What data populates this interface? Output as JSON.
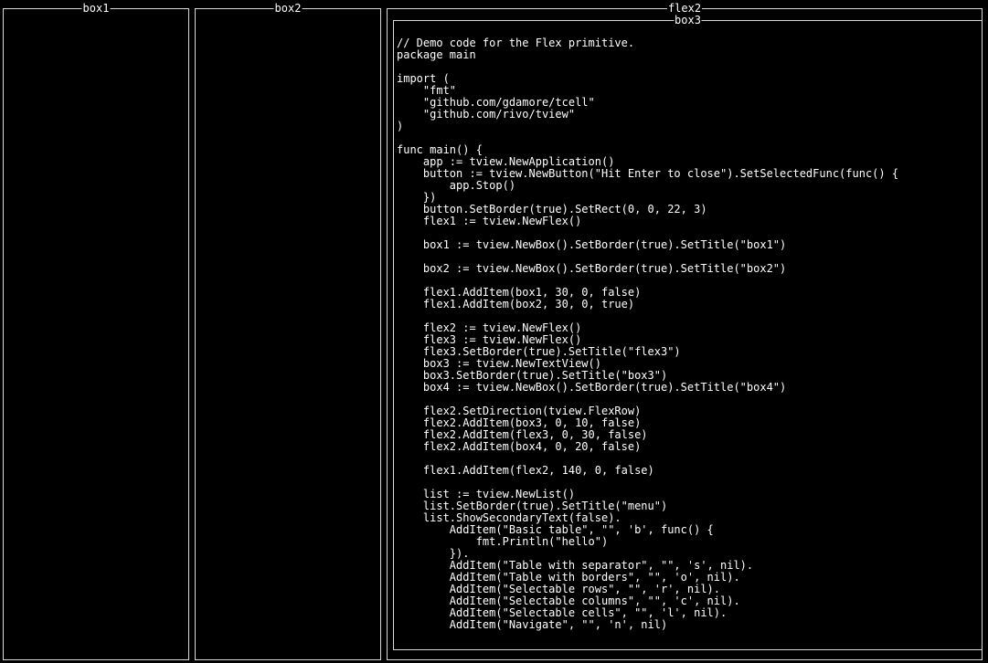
{
  "frames": {
    "box1_title": "box1",
    "box2_title": "box2",
    "flex2_title": "flex2",
    "box3_title": "box3"
  },
  "code_lines": [
    "// Demo code for the Flex primitive.",
    "package main",
    "",
    "import (",
    "    \"fmt\"",
    "    \"github.com/gdamore/tcell\"",
    "    \"github.com/rivo/tview\"",
    ")",
    "",
    "func main() {",
    "    app := tview.NewApplication()",
    "    button := tview.NewButton(\"Hit Enter to close\").SetSelectedFunc(func() {",
    "        app.Stop()",
    "    })",
    "    button.SetBorder(true).SetRect(0, 0, 22, 3)",
    "    flex1 := tview.NewFlex()",
    "",
    "    box1 := tview.NewBox().SetBorder(true).SetTitle(\"box1\")",
    "",
    "    box2 := tview.NewBox().SetBorder(true).SetTitle(\"box2\")",
    "",
    "    flex1.AddItem(box1, 30, 0, false)",
    "    flex1.AddItem(box2, 30, 0, true)",
    "",
    "    flex2 := tview.NewFlex()",
    "    flex3 := tview.NewFlex()",
    "    flex3.SetBorder(true).SetTitle(\"flex3\")",
    "    box3 := tview.NewTextView()",
    "    box3.SetBorder(true).SetTitle(\"box3\")",
    "    box4 := tview.NewBox().SetBorder(true).SetTitle(\"box4\")",
    "",
    "    flex2.SetDirection(tview.FlexRow)",
    "    flex2.AddItem(box3, 0, 10, false)",
    "    flex2.AddItem(flex3, 0, 30, false)",
    "    flex2.AddItem(box4, 0, 20, false)",
    "",
    "    flex1.AddItem(flex2, 140, 0, false)",
    "",
    "    list := tview.NewList()",
    "    list.SetBorder(true).SetTitle(\"menu\")",
    "    list.ShowSecondaryText(false).",
    "        AddItem(\"Basic table\", \"\", 'b', func() {",
    "            fmt.Println(\"hello\")",
    "        }).",
    "        AddItem(\"Table with separator\", \"\", 's', nil).",
    "        AddItem(\"Table with borders\", \"\", 'o', nil).",
    "        AddItem(\"Selectable rows\", \"\", 'r', nil).",
    "        AddItem(\"Selectable columns\", \"\", 'c', nil).",
    "        AddItem(\"Selectable cells\", \"\", 'l', nil).",
    "        AddItem(\"Navigate\", \"\", 'n', nil)"
  ]
}
